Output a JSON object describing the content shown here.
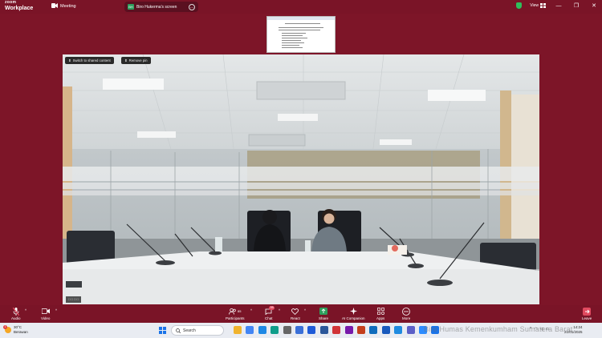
{
  "titlebar": {
    "logo_top": "zoom",
    "logo_bottom": "Workplace",
    "meeting_label": "Meeting",
    "share_badge": "BH",
    "share_title": "Biro Hukerma's screen",
    "view_label": "View",
    "window_buttons": [
      "—",
      "❐",
      "✕"
    ]
  },
  "video": {
    "overlay_buttons": [
      "Switch to shared content",
      "Remove pin"
    ],
    "name_tag": "□ □ □ □"
  },
  "toolbar": {
    "audio": "Audio",
    "video": "Video",
    "participants": "Participants",
    "participants_count": "85",
    "chat": "Chat",
    "chat_badge": "99",
    "react": "React",
    "share": "Share",
    "ai_companion": "AI Companion",
    "apps": "Apps",
    "more": "More",
    "leave": "Leave"
  },
  "taskbar": {
    "weather_temp": "30°C",
    "weather_desc": "Berawan",
    "weather_badge": "1",
    "search_placeholder": "Search",
    "watermark": "Biro Humas Kemenkumham Sumatera Barat",
    "time": "14:24",
    "date": "21/01/2025",
    "apps": [
      {
        "icon": "file-explorer-icon",
        "color": "#f0b32e"
      },
      {
        "icon": "chrome-icon",
        "color": "#4285f4"
      },
      {
        "icon": "gallery-icon",
        "color": "#1e88e5"
      },
      {
        "icon": "edge-icon",
        "color": "#0f9d8a"
      },
      {
        "icon": "settings-icon",
        "color": "#666666"
      },
      {
        "icon": "store-icon",
        "color": "#3a6fd8"
      },
      {
        "icon": "dropbox-icon",
        "color": "#1f5bd8"
      },
      {
        "icon": "word-icon",
        "color": "#2b579a"
      },
      {
        "icon": "app-red-icon",
        "color": "#d13438"
      },
      {
        "icon": "onenote-icon",
        "color": "#7719aa"
      },
      {
        "icon": "powerpoint-icon",
        "color": "#c43e1c"
      },
      {
        "icon": "outlook-icon",
        "color": "#0f6cbd"
      },
      {
        "icon": "word2-icon",
        "color": "#185abd"
      },
      {
        "icon": "globe-icon",
        "color": "#1f8be0"
      },
      {
        "icon": "teams-icon",
        "color": "#5b5fc7"
      },
      {
        "icon": "zoom-icon",
        "color": "#2d8cff"
      },
      {
        "icon": "app-blue-icon",
        "color": "#1a73e8"
      }
    ]
  },
  "colors": {
    "background": "#7d1528",
    "toolbar": "#7a1427",
    "taskbar": "#e9ecf2",
    "share_green": "#2e9d5c",
    "leave_red": "#e04a5f"
  }
}
